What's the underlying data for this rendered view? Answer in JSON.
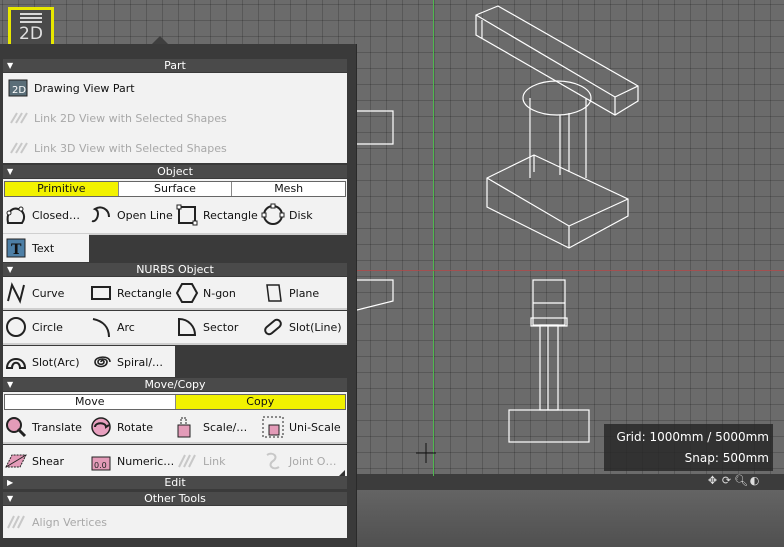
{
  "toggle": {
    "label": "2D"
  },
  "sections": {
    "part": {
      "title": "Part",
      "items": [
        {
          "label": "Drawing View Part",
          "enabled": true
        },
        {
          "label": "Link 2D View with Selected Shapes",
          "enabled": false
        },
        {
          "label": "Link 3D View with Selected Shapes",
          "enabled": false
        }
      ]
    },
    "object": {
      "title": "Object",
      "tabs": [
        "Primitive",
        "Surface",
        "Mesh"
      ],
      "active_tab": "Primitive",
      "items": [
        "Closed…",
        "Open Line",
        "Rectangle",
        "Disk",
        "Text"
      ]
    },
    "nurbs": {
      "title": "NURBS Object",
      "items": [
        "Curve",
        "Rectangle",
        "N-gon",
        "Plane",
        "Circle",
        "Arc",
        "Sector",
        "Slot(Line)",
        "Slot(Arc)",
        "Spiral/…"
      ]
    },
    "move_copy": {
      "title": "Move/Copy",
      "tabs": [
        "Move",
        "Copy"
      ],
      "active_tab": "Copy",
      "items": [
        "Translate",
        "Rotate",
        "Scale/…",
        "Uni-Scale",
        "Shear",
        "Numeric…",
        "Link",
        "Joint O…"
      ]
    },
    "edit": {
      "title": "Edit"
    },
    "other": {
      "title": "Other Tools",
      "items": [
        "Align Vertices"
      ]
    }
  },
  "hud": {
    "grid": "Grid: 1000mm / 5000mm",
    "snap": "Snap: 500mm"
  },
  "colors": {
    "highlight": "#f2f200",
    "panel_bg": "#f2f2f2",
    "header": "#4a4a4a"
  }
}
